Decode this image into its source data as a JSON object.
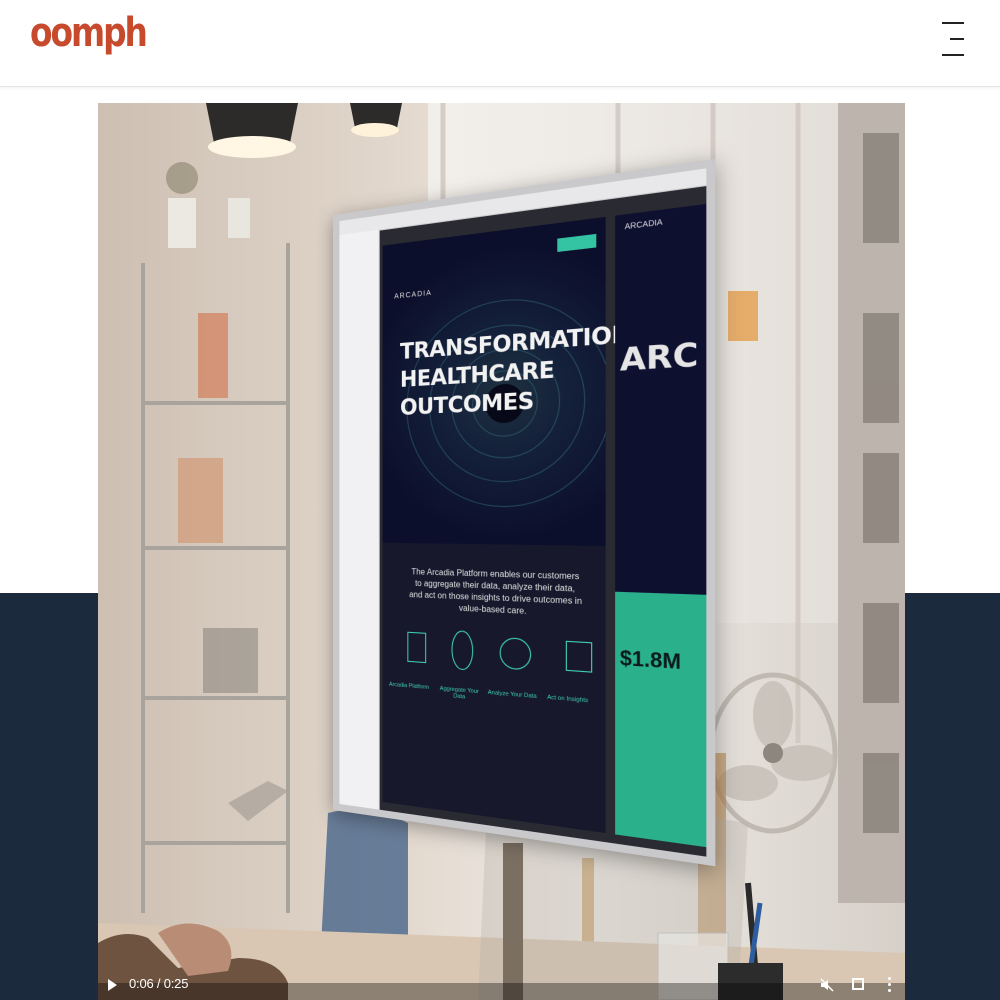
{
  "header": {
    "logo_text": "oomph",
    "brand_color": "#c84a2d",
    "menu_icon": "hamburger-menu-icon"
  },
  "hero_section": {
    "band_color": "#1b2b3d"
  },
  "video": {
    "scene_description_icon": "video-frame",
    "screen_content": {
      "brand": "ARCADIA",
      "headline_line1": "TRANSFORMATIONAL",
      "headline_line2": "HEALTHCARE",
      "headline_line3": "OUTCOMES",
      "body": "The Arcadia Platform enables our customers to aggregate their data, analyze their data, and act on those insights to drive outcomes in value-based care.",
      "features": [
        "Arcadia Platform",
        "Aggregate Your Data",
        "Analyze Your Data",
        "Act on Insights"
      ],
      "side_panel_title": "ARC",
      "side_panel_stat": "$1.8M"
    },
    "controls": {
      "time": "0:06 / 0:25",
      "played_fraction": 0.24,
      "play_icon": "play-icon",
      "mute_icon": "volume-muted-icon",
      "fullscreen_icon": "fullscreen-icon",
      "more_icon": "more-options-icon"
    }
  }
}
